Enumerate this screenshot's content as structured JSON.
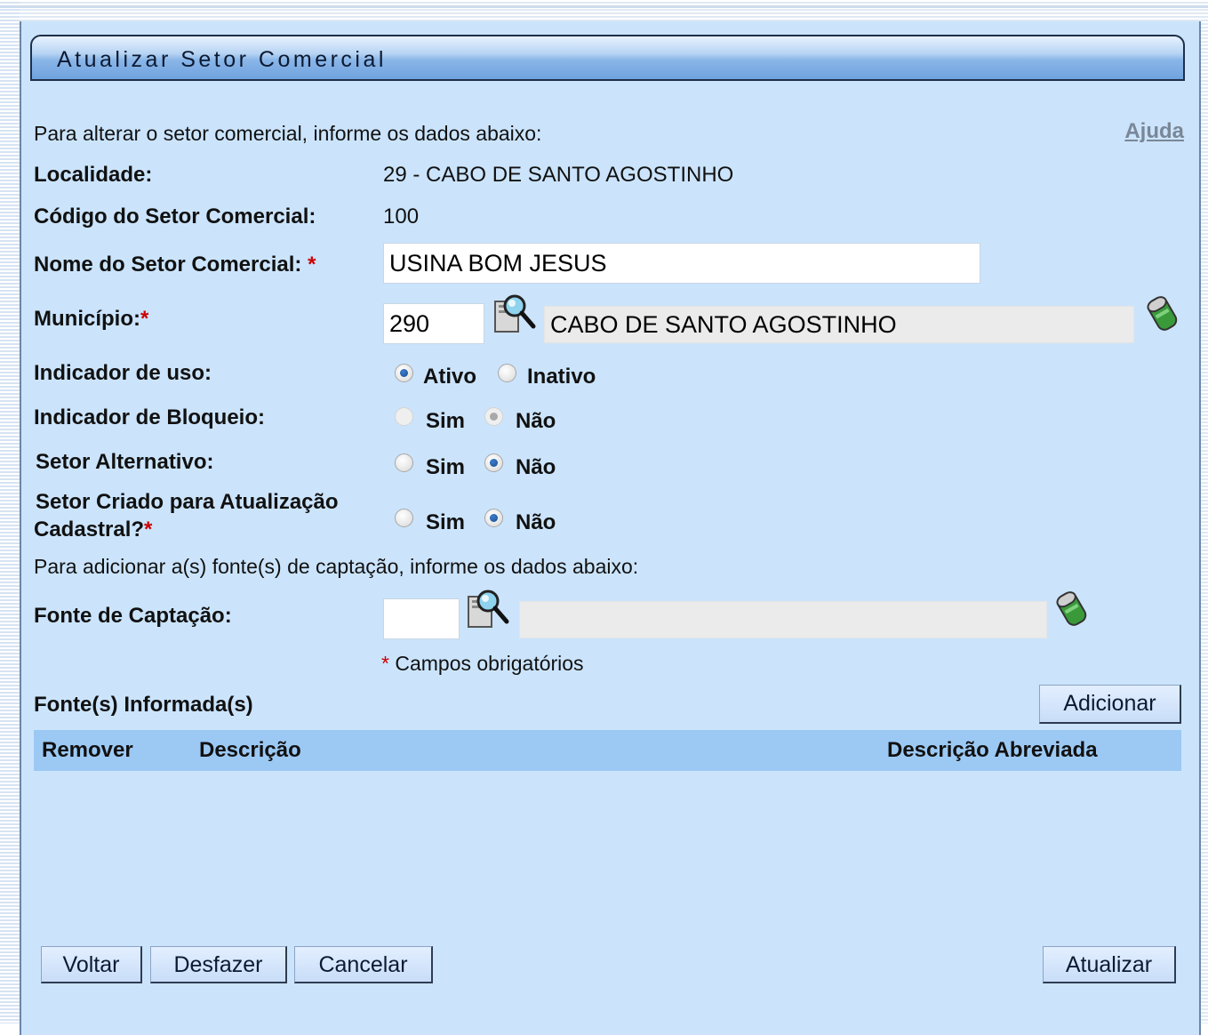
{
  "title": "Atualizar Setor Comercial",
  "intro": "Para alterar o setor comercial, informe os dados abaixo:",
  "help": "Ajuda",
  "localidade": {
    "label": "Localidade:",
    "value": "29 - CABO DE SANTO AGOSTINHO"
  },
  "codigo": {
    "label": "Código do Setor Comercial:",
    "value": "100"
  },
  "nome": {
    "label": "Nome do Setor Comercial:",
    "required": "*",
    "value": "USINA BOM JESUS"
  },
  "municipio": {
    "label": "Município:",
    "required": "*",
    "code": "290",
    "name": "CABO DE SANTO AGOSTINHO"
  },
  "indicador_uso": {
    "label": "Indicador de uso:",
    "options": [
      "Ativo",
      "Inativo"
    ],
    "selected": "Ativo"
  },
  "indicador_bloqueio": {
    "label": "Indicador de Bloqueio:",
    "options": [
      "Sim",
      "Não"
    ],
    "selected": "Não",
    "disabled": true
  },
  "setor_alternativo": {
    "label": "Setor Alternativo:",
    "options": [
      "Sim",
      "Não"
    ],
    "selected": "Não"
  },
  "setor_criado": {
    "label_line1": "Setor Criado para Atualização",
    "label_line2": "Cadastral?",
    "required": "*",
    "options": [
      "Sim",
      "Não"
    ],
    "selected": "Não"
  },
  "captacao_intro": "Para adicionar a(s) fonte(s) de captação, informe os dados abaixo:",
  "fonte": {
    "label": "Fonte de Captação:",
    "code": "",
    "name": ""
  },
  "required_note": {
    "star": "*",
    "text": "Campos obrigatórios"
  },
  "fontes_informadas": {
    "label": "Fonte(s) Informada(s)",
    "add_button": "Adicionar"
  },
  "table": {
    "columns": [
      "Remover",
      "Descrição",
      "Descrição Abreviada"
    ]
  },
  "buttons": {
    "back": "Voltar",
    "undo": "Desfazer",
    "cancel": "Cancelar",
    "update": "Atualizar"
  },
  "icons": [
    "search-icon",
    "eraser-icon"
  ]
}
